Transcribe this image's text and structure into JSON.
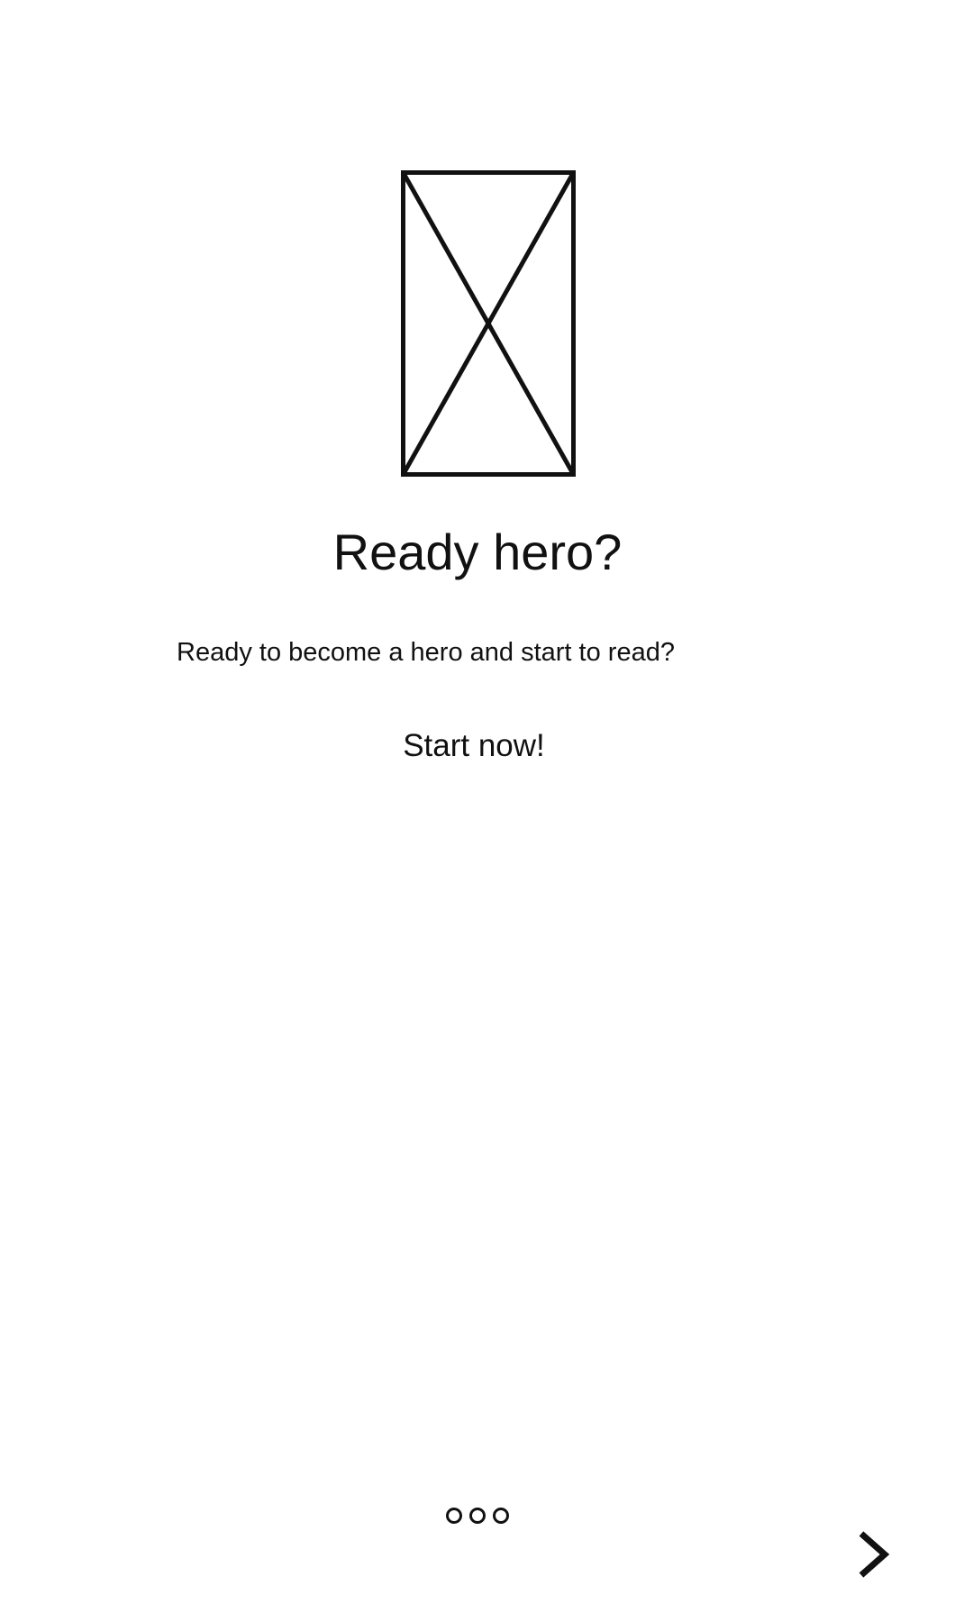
{
  "onboarding": {
    "image_icon": "image-placeholder-icon",
    "title": "Ready hero?",
    "subtitle": "Ready to become a hero and start to read?",
    "cta_label": "Start now!",
    "pager": {
      "pages": 3
    },
    "next_icon": "chevron-right-icon"
  }
}
